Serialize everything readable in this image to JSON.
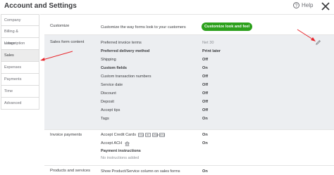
{
  "header": {
    "title": "Account and Settings",
    "help_label": "Help"
  },
  "sidebar": {
    "items": [
      {
        "label": "Company"
      },
      {
        "label": "Billing & subscription"
      },
      {
        "label": "Usage"
      },
      {
        "label": "Sales"
      },
      {
        "label": "Expenses"
      },
      {
        "label": "Payments"
      },
      {
        "label": "Time"
      },
      {
        "label": "Advanced"
      }
    ]
  },
  "customize": {
    "label": "Customize",
    "description": "Customize the way forms look to your customers",
    "button_label": "Customize look and feel"
  },
  "sales_form": {
    "label": "Sales form content",
    "rows": [
      {
        "name": "Preferred invoice terms",
        "value": "Net 30"
      },
      {
        "name": "Preferred delivery method",
        "value": "Print later"
      },
      {
        "name": "Shipping",
        "value": "Off"
      },
      {
        "name": "Custom fields",
        "value": "On"
      },
      {
        "name": "Custom transaction numbers",
        "value": "Off"
      },
      {
        "name": "Service date",
        "value": "Off"
      },
      {
        "name": "Discount",
        "value": "Off"
      },
      {
        "name": "Deposit",
        "value": "Off"
      },
      {
        "name": "Accept tips",
        "value": "Off"
      },
      {
        "name": "Tags",
        "value": "On"
      }
    ]
  },
  "invoice_payments": {
    "label": "Invoice payments",
    "rows": [
      {
        "name": "Accept Credit Cards",
        "value": "On"
      },
      {
        "name": "Accept ACH",
        "value": "On"
      }
    ],
    "card_brands": [
      "VISA",
      "MC",
      "AMEX",
      "DISC"
    ],
    "payment_instructions_label": "Payment instructions",
    "payment_instructions_value": "No instructions added"
  },
  "products_services": {
    "label": "Products and services",
    "row": {
      "name": "Show Product/Service column on sales forms",
      "value": "On"
    }
  },
  "colors": {
    "accent": "#2ca01c",
    "arrow": "#e8252b",
    "highlight": "#eceef1"
  }
}
